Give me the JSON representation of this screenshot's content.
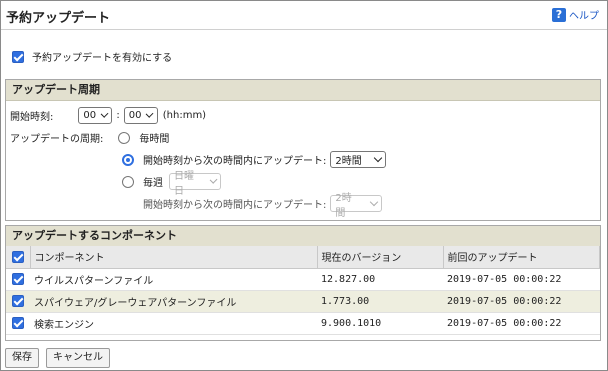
{
  "title": "予約アップデート",
  "help": {
    "label": "ヘルプ",
    "icon": "help-icon"
  },
  "enable": {
    "label": "予約アップデートを有効にする",
    "checked": true
  },
  "schedule": {
    "header": "アップデート周期",
    "start_time_label": "開始時刻:",
    "hour": "00",
    "minute": "00",
    "time_colon": ":",
    "time_format": "(hh:mm)",
    "period_label": "アップデートの周期:",
    "options": {
      "hourly": "毎時間",
      "within_label": "開始時刻から次の時間内にアップデート:",
      "within_value": "2時間",
      "weekly": "毎週",
      "weekday": "日曜日",
      "weekly_within_label": "開始時刻から次の時間内にアップデート:",
      "weekly_within_value": "2時間"
    },
    "selected": "within"
  },
  "components": {
    "header": "アップデートするコンポーネント",
    "columns": [
      "コンポーネント",
      "現在のバージョン",
      "前回のアップデート"
    ],
    "rows": [
      {
        "name": "ウイルスパターンファイル",
        "version": "12.827.00",
        "last": "2019-07-05 00:00:22",
        "checked": true
      },
      {
        "name": "スパイウェア/グレーウェアパターンファイル",
        "version": "1.773.00",
        "last": "2019-07-05 00:00:22",
        "checked": true
      },
      {
        "name": "検索エンジン",
        "version": "9.900.1010",
        "last": "2019-07-05 00:00:22",
        "checked": true
      }
    ]
  },
  "buttons": {
    "save": "保存",
    "cancel": "キャンセル"
  },
  "colors": {
    "accent": "#2f6fe0",
    "section_header": "#e2e0cf",
    "alt_row": "#eeeedf"
  }
}
